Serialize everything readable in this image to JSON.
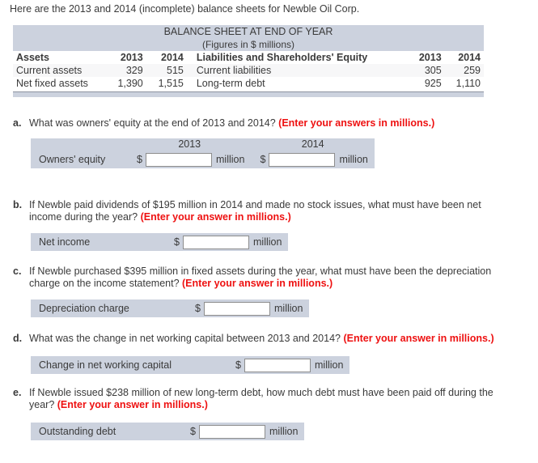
{
  "intro": "Here are the 2013 and 2014 (incomplete) balance sheets for Newble Oil Corp.",
  "balance_sheet": {
    "title": "BALANCE SHEET AT END OF YEAR",
    "subtitle": "(Figures in $ millions)",
    "headers": {
      "assets": "Assets",
      "assets_y1": "2013",
      "assets_y2": "2014",
      "liabilities": "Liabilities and Shareholders' Equity",
      "liab_y1": "2013",
      "liab_y2": "2014"
    },
    "rows": [
      {
        "asset_label": "Current assets",
        "asset_2013": "329",
        "asset_2014": "515",
        "liab_label": "Current liabilities",
        "liab_2013": "305",
        "liab_2014": "259"
      },
      {
        "asset_label": "Net fixed assets",
        "asset_2013": "1,390",
        "asset_2014": "1,515",
        "liab_label": "Long-term debt",
        "liab_2013": "925",
        "liab_2014": "1,110"
      }
    ]
  },
  "questions": [
    {
      "letter": "a.",
      "text": "What was owners' equity at the end of 2013 and 2014? ",
      "instruction": "(Enter your answers in millions.)",
      "answer": {
        "year_headers": [
          "2013",
          "2014"
        ],
        "label": "Owners' equity",
        "dollar": "$",
        "unit": "million",
        "value1": "",
        "value2": ""
      }
    },
    {
      "letter": "b.",
      "text": "If Newble paid dividends of $195 million in 2014 and made no stock issues, what must have been net income during the year? ",
      "instruction": "(Enter your answer in millions.)",
      "answer": {
        "label": "Net income",
        "dollar": "$",
        "unit": "million",
        "value1": ""
      }
    },
    {
      "letter": "c.",
      "text": "If Newble purchased $395 million  in fixed assets during the year, what must have been the depreciation charge on the income statement? ",
      "instruction": "(Enter your answer in millions.)",
      "answer": {
        "label": "Depreciation charge",
        "dollar": "$",
        "unit": "million",
        "value1": ""
      }
    },
    {
      "letter": "d.",
      "text": "What was the change in net working capital between 2013 and 2014? ",
      "instruction": "(Enter your answer in millions.)",
      "answer": {
        "label": "Change in net working capital",
        "dollar": "$",
        "unit": "million",
        "value1": ""
      }
    },
    {
      "letter": "e.",
      "text": "If Newble issued $238 million of new long-term debt, how much debt must have been paid off during the year? ",
      "instruction": "(Enter your answer in millions.)",
      "answer": {
        "label": "Outstanding debt",
        "dollar": "$",
        "unit": "million",
        "value1": ""
      }
    }
  ],
  "colors": {
    "band": "#ccd2de",
    "red": "#ee1111",
    "text": "#3a3a3a",
    "row_alt": "#f7f7f8"
  }
}
